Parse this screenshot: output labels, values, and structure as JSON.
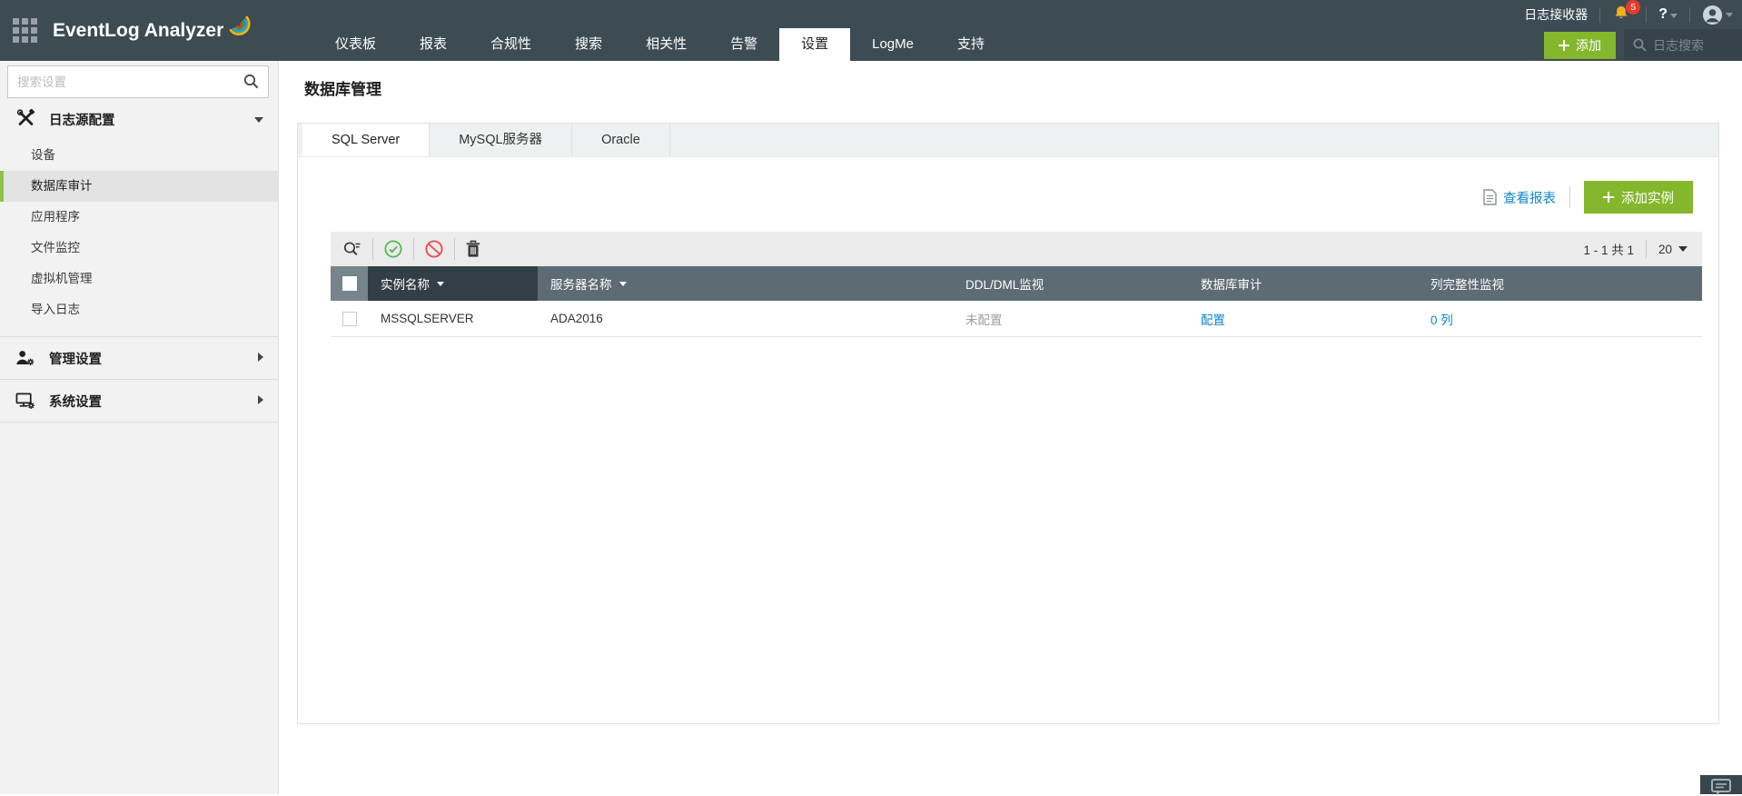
{
  "topbar": {
    "logo_text": "EventLog Analyzer",
    "nav": [
      {
        "label": "仪表板"
      },
      {
        "label": "报表"
      },
      {
        "label": "合规性"
      },
      {
        "label": "搜索"
      },
      {
        "label": "相关性"
      },
      {
        "label": "告警"
      },
      {
        "label": "设置",
        "active": true
      },
      {
        "label": "LogMe"
      },
      {
        "label": "支持"
      }
    ],
    "log_receiver_label": "日志接收器",
    "notification_count": "5",
    "help_label": "?",
    "add_button_label": "添加",
    "log_search_placeholder": "日志搜索"
  },
  "sidebar": {
    "search_placeholder": "搜索设置",
    "sections": [
      {
        "label": "日志源配置",
        "expanded": true,
        "items": [
          {
            "label": "设备"
          },
          {
            "label": "数据库审计",
            "selected": true
          },
          {
            "label": "应用程序"
          },
          {
            "label": "文件监控"
          },
          {
            "label": "虚拟机管理"
          },
          {
            "label": "导入日志"
          }
        ]
      },
      {
        "label": "管理设置",
        "expanded": false
      },
      {
        "label": "系统设置",
        "expanded": false
      }
    ]
  },
  "main": {
    "page_title": "数据库管理",
    "tabs": [
      {
        "label": "SQL Server",
        "active": true
      },
      {
        "label": "MySQL服务器"
      },
      {
        "label": "Oracle"
      }
    ],
    "actions": {
      "view_reports_label": "查看报表",
      "add_instance_label": "添加实例"
    },
    "pagination": {
      "range_label": "1 - 1 共 1",
      "page_size": "20"
    },
    "table": {
      "columns": [
        {
          "label": "实例名称",
          "sortable": true,
          "sorted": true
        },
        {
          "label": "服务器名称",
          "sortable": true
        },
        {
          "label": "DDL/DML监视"
        },
        {
          "label": "数据库审计"
        },
        {
          "label": "列完整性监视"
        }
      ],
      "rows": [
        {
          "instance_name": "MSSQLSERVER",
          "server_name": "ADA2016",
          "ddl_dml_monitor": "未配置",
          "database_audit": "配置",
          "column_integrity": "0 列"
        }
      ]
    }
  },
  "colors": {
    "topbar_bg": "#3d4b53",
    "accent_green": "#85b72c",
    "link_blue": "#0d84ce",
    "table_header_bg": "#5d6b74",
    "table_header_sorted_bg": "#333f47",
    "table_header_checkbox_bg": "#76848c",
    "sidebar_selected_border": "#8bc34a",
    "notification_badge_red": "#e6392e",
    "status_unconfigured_gray": "#9aa0a4"
  }
}
